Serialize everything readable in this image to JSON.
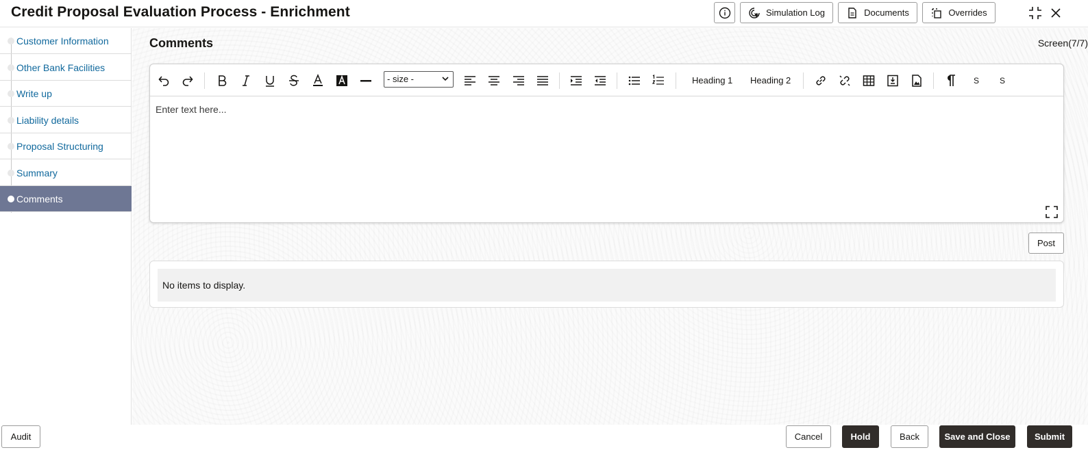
{
  "header": {
    "title": "Credit Proposal Evaluation Process - Enrichment",
    "buttons": {
      "simulation_log": "Simulation Log",
      "documents": "Documents",
      "overrides": "Overrides"
    }
  },
  "sidebar": {
    "items": [
      {
        "label": "Customer Information",
        "active": false
      },
      {
        "label": "Other Bank Facilities",
        "active": false
      },
      {
        "label": "Write up",
        "active": false
      },
      {
        "label": "Liability details",
        "active": false
      },
      {
        "label": "Proposal Structuring",
        "active": false
      },
      {
        "label": "Summary",
        "active": false
      },
      {
        "label": "Comments",
        "active": true
      }
    ]
  },
  "main": {
    "title": "Comments",
    "screen_count": "Screen(7/7)",
    "editor": {
      "size_select": "- size -",
      "heading1": "Heading 1",
      "heading2": "Heading 2",
      "s1": "S",
      "s2": "S",
      "placeholder": "Enter text here..."
    },
    "post_label": "Post",
    "empty_message": "No items to display."
  },
  "footer": {
    "audit": "Audit",
    "cancel": "Cancel",
    "hold": "Hold",
    "back": "Back",
    "save_close": "Save and Close",
    "submit": "Submit"
  },
  "colors": {
    "active_nav": "#6e7794",
    "link": "#11699d",
    "dark_button": "#312d2a"
  }
}
